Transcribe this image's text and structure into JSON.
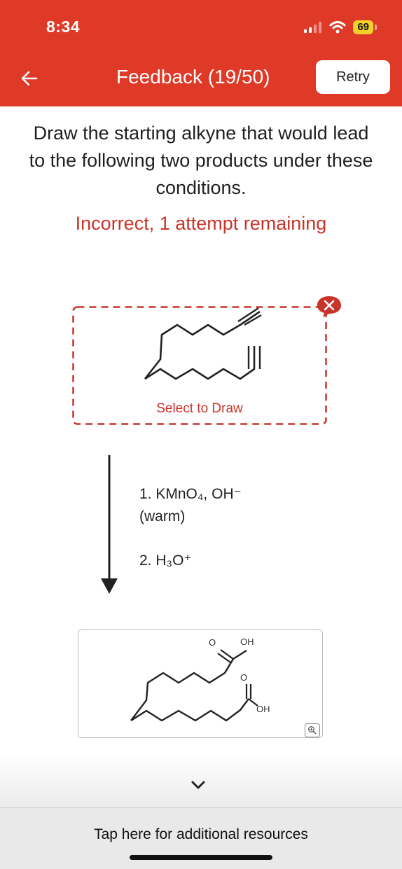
{
  "status_bar": {
    "time": "8:34",
    "battery_level": "69"
  },
  "header": {
    "title": "Feedback (19/50)",
    "retry_label": "Retry",
    "back_icon": "arrow-left-icon",
    "background_color": "#de3a27"
  },
  "question": {
    "text": "Draw the starting alkyne that would lead to the following two products under these conditions.",
    "status": "Incorrect, 1 attempt remaining",
    "status_color": "#c8342a"
  },
  "draw_area": {
    "label": "Select to Draw",
    "badge_icon": "x-icon"
  },
  "reaction": {
    "step1_line1": "1. KMnO₄, OH⁻",
    "step1_line2": "(warm)",
    "step2": "2. H₃O⁺"
  },
  "products": {
    "acid1_o": "O",
    "acid1_oh": "OH",
    "acid2_o": "O",
    "acid2_oh": "OH",
    "zoom_icon": "zoom-icon"
  },
  "footer": {
    "resources_label": "Tap here for additional resources",
    "expand_icon": "chevron-down-icon"
  }
}
